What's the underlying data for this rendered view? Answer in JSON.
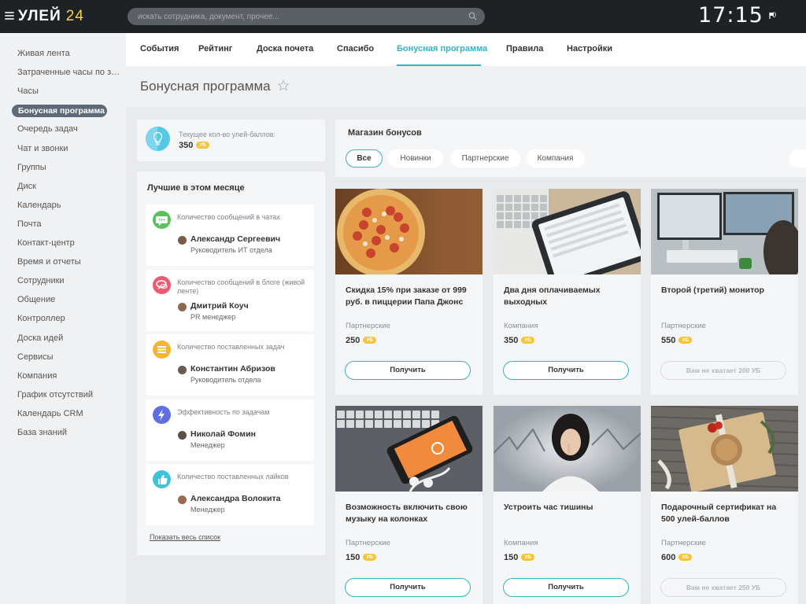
{
  "header": {
    "logo_text": "УЛЕЙ",
    "logo_number": "24",
    "search_placeholder": "искать сотрудника, документ, прочее...",
    "clock": "17:15",
    "notifications_count": "0"
  },
  "sidebar": {
    "items": [
      {
        "label": "Живая лента"
      },
      {
        "label": "Затраченные часы по задачам"
      },
      {
        "label": "Часы"
      },
      {
        "label": "Бонусная программа",
        "active": true
      },
      {
        "label": "Очередь задач"
      },
      {
        "label": "Чат и звонки"
      },
      {
        "label": "Группы"
      },
      {
        "label": "Диск"
      },
      {
        "label": "Календарь"
      },
      {
        "label": "Почта"
      },
      {
        "label": "Контакт-центр"
      },
      {
        "label": "Время и отчеты"
      },
      {
        "label": "Сотрудники"
      },
      {
        "label": "Общение"
      },
      {
        "label": "Контроллер"
      },
      {
        "label": "Доска идей"
      },
      {
        "label": "Сервисы"
      },
      {
        "label": "Компания"
      },
      {
        "label": "График отсутствий"
      },
      {
        "label": "Календарь CRM"
      },
      {
        "label": "База знаний"
      }
    ]
  },
  "tabs": [
    {
      "label": "События"
    },
    {
      "label": "Рейтинг"
    },
    {
      "label": "Доска почета"
    },
    {
      "label": "Спасибо"
    },
    {
      "label": "Бонусная программа",
      "active": true
    },
    {
      "label": "Правила"
    },
    {
      "label": "Настройки"
    }
  ],
  "page": {
    "title": "Бонусная программа"
  },
  "balance": {
    "label": "Текущее кол-во улей-баллов:",
    "value": "350",
    "currency": "УБ"
  },
  "best": {
    "title": "Лучшие в этом месяце",
    "show_all": "Показать весь список",
    "items": [
      {
        "category": "Количество сообщений в чатах",
        "name": "Александр Сергеевич",
        "role": "Руководитель ИТ отдела",
        "icon": "chat-icon",
        "color": "#5cc15c"
      },
      {
        "category": "Количество сообщений в блоге (живой ленте)",
        "name": "Дмитрий Коуч",
        "role": "PR менеджер",
        "icon": "comments-icon",
        "color": "#ef5a6e"
      },
      {
        "category": "Количество поставленных задач",
        "name": "Константин Абризов",
        "role": "Руководитель отдела",
        "icon": "tasks-icon",
        "color": "#f5b531"
      },
      {
        "category": "Эффективность по задачам",
        "name": "Николай Фомин",
        "role": "Менеджер",
        "icon": "lightning-icon",
        "color": "#5f6ee0"
      },
      {
        "category": "Количество поставленных лайков",
        "name": "Александра Волокита",
        "role": "Менеджер",
        "icon": "thumbs-up-icon",
        "color": "#3fc3d8"
      }
    ]
  },
  "shop": {
    "title": "Магазин бонусов",
    "filters": [
      {
        "label": "Все",
        "active": true
      },
      {
        "label": "Новинки"
      },
      {
        "label": "Партнерские"
      },
      {
        "label": "Компания"
      }
    ],
    "products": [
      {
        "title": "Скидка 15% при заказе от 999 руб. в пиццерии Папа Джонс",
        "category": "Партнерские",
        "price": "250",
        "button": "Получить",
        "available": true,
        "image": "pizza"
      },
      {
        "title": "Два дня оплачиваемых выходных",
        "category": "Компания",
        "price": "350",
        "button": "Получить",
        "available": true,
        "image": "tablet"
      },
      {
        "title": "Второй (третий) монитор",
        "category": "Партнерские",
        "price": "550",
        "button": "Вам не хватает 200 УБ",
        "available": false,
        "image": "monitor"
      },
      {
        "title": "Возможность включить свою музыку на колонках",
        "category": "Партнерские",
        "price": "150",
        "button": "Получить",
        "available": true,
        "image": "phone"
      },
      {
        "title": "Устроить час тишины",
        "category": "Компания",
        "price": "150",
        "button": "Получить",
        "available": true,
        "image": "silence"
      },
      {
        "title": "Подарочный сертификат на 500 улей-баллов",
        "category": "Партнерские",
        "price": "600",
        "button": "Вам не хватает 250 УБ",
        "available": false,
        "image": "gift"
      }
    ]
  },
  "colors": {
    "accent": "#2fb5c9",
    "badge": "#f5c437",
    "topbar": "#1f2224",
    "sidebar_active": "#5d6b79"
  }
}
